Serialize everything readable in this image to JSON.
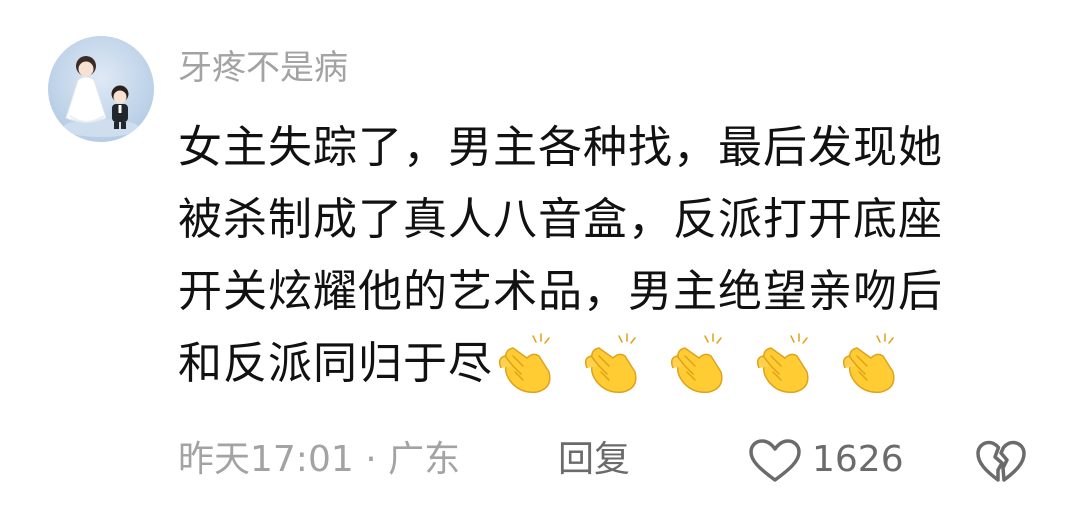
{
  "comment": {
    "username": "牙疼不是病",
    "content_lines": [
      "女主失踪了，男主各种找，最后发现她",
      "被杀制成了真人八音盒，反派打开底座",
      "开关炫耀他的艺术品，男主绝望亲吻后",
      "和反派同归于尽"
    ],
    "emoji": [
      "clapping-hands",
      "clapping-hands",
      "clapping-hands",
      "clapping-hands",
      "clapping-hands"
    ],
    "time_location": "昨天17:01 · 广东",
    "reply_label": "回复",
    "like_count": "1626",
    "icons": {
      "like": "heart-outline-icon",
      "dislike": "broken-heart-icon"
    },
    "colors": {
      "meta_text": "#a3a3a3",
      "body_text": "#111111",
      "clap": "#ffcc33"
    }
  }
}
